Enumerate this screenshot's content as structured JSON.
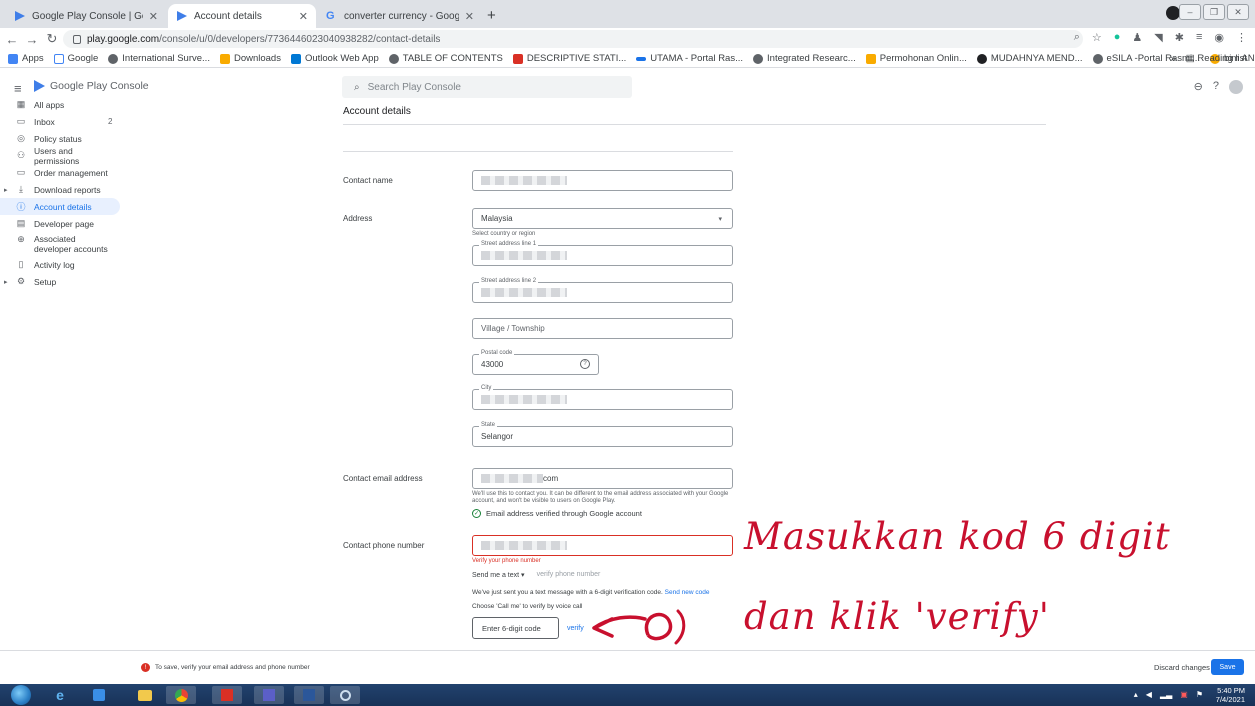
{
  "browser": {
    "tabs": [
      {
        "label": "Google Play Console | Google Pl",
        "active": false
      },
      {
        "label": "Account details",
        "active": true
      },
      {
        "label": "converter currency - Google Sea",
        "active": false
      }
    ],
    "new_tab": "+",
    "url_host": "play.google.com",
    "url_path": "/console/u/0/developers/7736446023040938282/contact-details",
    "bookmarks": [
      "Apps",
      "Google",
      "International Surve...",
      "Downloads",
      "Outlook Web App",
      "TABLE OF CONTENTS",
      "DESCRIPTIVE STATI...",
      "UTAMA - Portal Ras...",
      "Integrated Researc...",
      "Permohonan Onlin...",
      "MUDAHNYA MEND...",
      "eSILA -Portal Rasmi...",
      "bim AND facilities..."
    ],
    "reading_list": "Reading list",
    "overflow": "»"
  },
  "app": {
    "logo_text": "Google Play Console",
    "search_placeholder": "Search Play Console"
  },
  "sidebar": {
    "items": [
      {
        "label": "All apps",
        "icon": "grid-icon"
      },
      {
        "label": "Inbox",
        "icon": "inbox-icon",
        "count": "2"
      },
      {
        "label": "Policy status",
        "icon": "shield-icon"
      },
      {
        "label": "Users and permissions",
        "icon": "users-icon"
      },
      {
        "label": "Order management",
        "icon": "card-icon"
      },
      {
        "label": "Download reports",
        "icon": "download-icon",
        "expandable": true
      },
      {
        "label": "Account details",
        "icon": "account-icon",
        "active": true
      },
      {
        "label": "Developer page",
        "icon": "page-icon"
      },
      {
        "label": "Associated developer accounts",
        "icon": "link-accounts-icon"
      },
      {
        "label": "Activity log",
        "icon": "log-icon"
      },
      {
        "label": "Setup",
        "icon": "gear-icon",
        "expandable": true
      }
    ]
  },
  "form": {
    "title": "Account details",
    "contact_name_label": "Contact name",
    "address_label": "Address",
    "country_value": "Malaysia",
    "country_helper": "Select country or region",
    "street1_label": "Street address line 1",
    "street2_label": "Street address line 2",
    "village_placeholder": "Village / Township",
    "postal_label": "Postal code",
    "postal_value": "43000",
    "city_label": "City",
    "state_label": "State",
    "state_value": "Selangor",
    "email_label": "Contact email address",
    "email_suffix": "com",
    "email_helper": "We'll use this to contact you. It can be different to the email address associated with your Google account, and won't be visible to users on Google Play.",
    "email_verified": "Email address verified through Google account",
    "phone_label": "Contact phone number",
    "phone_error": "Verify your phone number",
    "send_me": "Send me a text",
    "verify_phone": "verify phone number",
    "sent_msg": "We've just sent you a text message with a 6-digit verification code.",
    "send_new_code": "Send new code",
    "call_msg": "Choose 'Call me' to verify by voice call",
    "code_placeholder": "Enter 6-digit code",
    "verify": "verify"
  },
  "annotation": {
    "line1": "Masukkan kod 6 digit",
    "line2": "dan klik 'verify'",
    "color": "#c8102e"
  },
  "savebar": {
    "warning": "To save, verify your email address and phone number",
    "discard": "Discard changes",
    "save": "Save"
  },
  "taskbar": {
    "time": "5:40 PM",
    "date": "7/4/2021"
  }
}
